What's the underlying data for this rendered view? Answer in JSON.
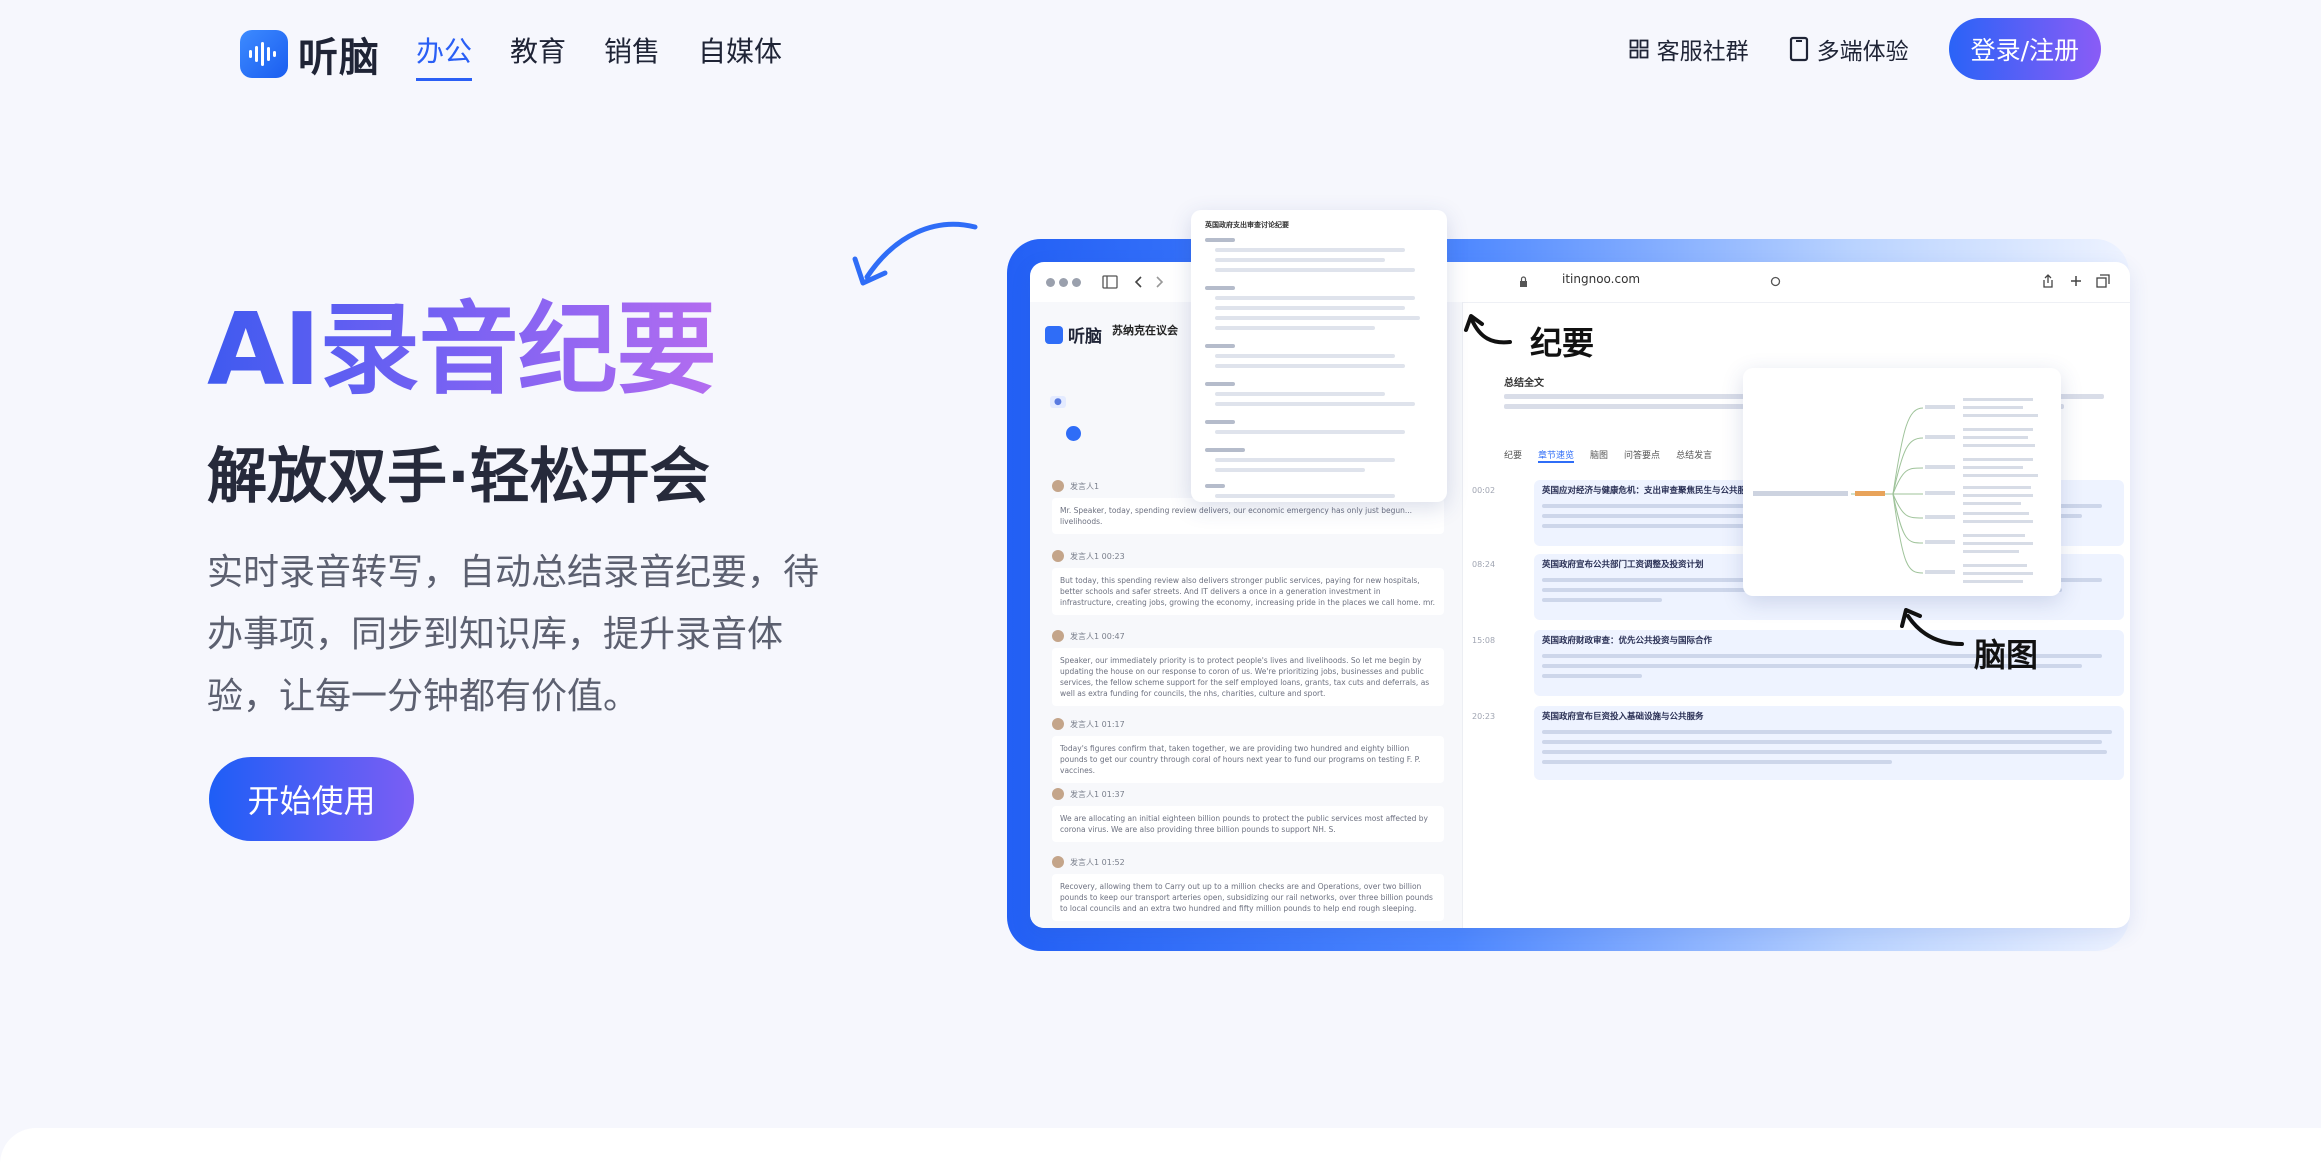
{
  "nav": {
    "brand": "听脑",
    "links": [
      {
        "label": "办公",
        "active": true
      },
      {
        "label": "教育",
        "active": false
      },
      {
        "label": "销售",
        "active": false
      },
      {
        "label": "自媒体",
        "active": false
      }
    ],
    "community_label": "客服社群",
    "multi_device_label": "多端体验",
    "login_label": "登录/注册"
  },
  "hero": {
    "title": "AI录音纪要",
    "subtitle": "解放双手·轻松开会",
    "description": "实时录音转写，自动总结录音纪要，待办事项，同步到知识库，提升录音体验，让每一分钟都有价值。",
    "cta_label": "开始使用"
  },
  "mockup": {
    "url": "itingnoo.com",
    "app_brand": "听脑",
    "meeting_title": "苏纳克在议会",
    "summary_label": "总结全文",
    "tabs": [
      "纪要",
      "章节速览",
      "脑图",
      "问答要点",
      "总结发言"
    ],
    "annotation_minutes": "纪要",
    "annotation_mindmap": "脑图",
    "messages": [
      {
        "speaker": "发言人1",
        "time": "",
        "text": "Mr. Speaker, today, spending review delivers, our economic emergency has only just begun... livelihoods."
      },
      {
        "speaker": "发言人1",
        "time": "00:23",
        "text": "But today, this spending review also delivers stronger public services, paying for new hospitals, better schools and safer streets. And IT delivers a once in a generation investment in infrastructure, creating jobs, growing the economy, increasing pride in the places we call home. mr."
      },
      {
        "speaker": "发言人1",
        "time": "00:47",
        "text": "Speaker, our immediately priority is to protect people's lives and livelihoods. So let me begin by updating the house on our response to coron of us. We're prioritizing jobs, businesses and public services, the fellow scheme support for the self employed loans, grants, tax cuts and deferrals, as well as extra funding for councils, the nhs, charities, culture and sport."
      },
      {
        "speaker": "发言人1",
        "time": "01:17",
        "text": "Today's figures confirm that, taken together, we are providing two hundred and eighty billion pounds to get our country through coral of hours next year to fund our programs on testing F. P. vaccines."
      },
      {
        "speaker": "发言人1",
        "time": "01:37",
        "text": "We are allocating an initial eighteen billion pounds to protect the public services most affected by corona virus. We are also providing three billion pounds to support NH. S."
      },
      {
        "speaker": "发言人1",
        "time": "01:52",
        "text": "Recovery, allowing them to Carry out up to a million checks are and Operations, over two billion pounds to keep our transport arteries open, subsidizing our rail networks, over three billion pounds to local councils and an extra two hundred and fifty million pounds to help end rough sleeping."
      }
    ],
    "chapters": [
      {
        "time": "00:02",
        "title": "英国应对经济与健康危机：支出审查聚焦民生与公共服务"
      },
      {
        "time": "08:24",
        "title": "英国政府宣布公共部门工资调整及投资计划"
      },
      {
        "time": "15:08",
        "title": "英国政府财政审查：优先公共投资与国际合作"
      },
      {
        "time": "20:23",
        "title": "英国政府宣布巨资投入基础设施与公共服务"
      }
    ],
    "outline_title": "英国政府支出审查讨论纪要"
  }
}
